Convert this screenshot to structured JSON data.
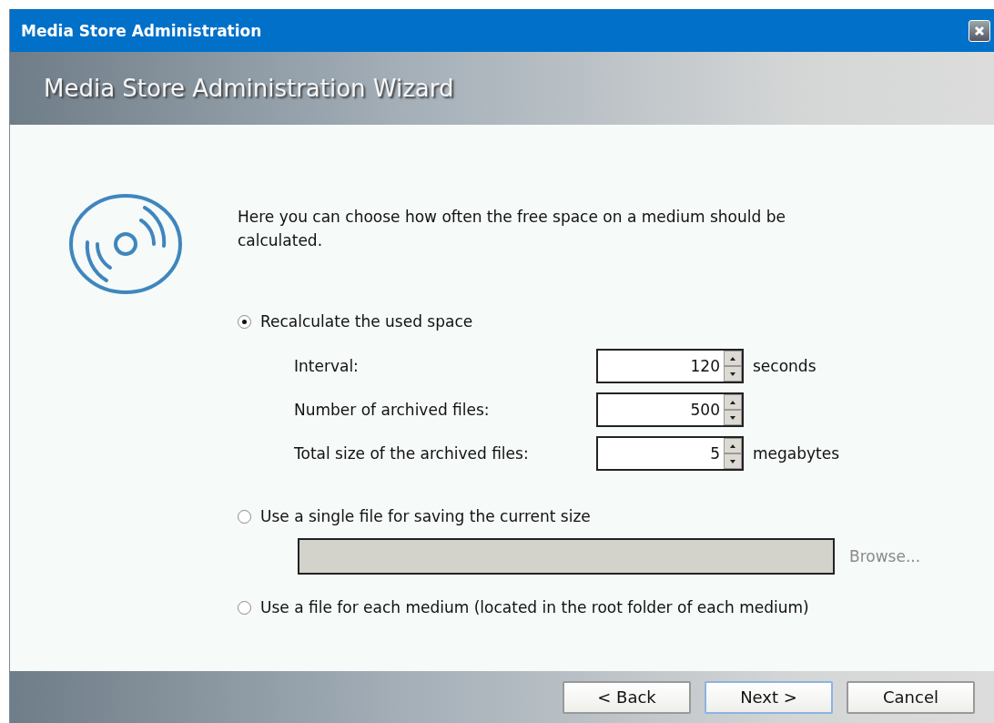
{
  "window": {
    "title": "Media Store Administration"
  },
  "header": {
    "title": "Media Store Administration Wizard"
  },
  "intro": "Here you can choose how often the free space on a medium should be calculated.",
  "options": [
    {
      "kind": "spinners",
      "label": "Recalculate the used space",
      "selected": true,
      "fields": [
        {
          "label": "Interval:",
          "value": "120",
          "unit": "seconds"
        },
        {
          "label": "Number of archived files:",
          "value": "500"
        },
        {
          "label": "Total size of the archived files:",
          "value": "5",
          "unit": "megabytes"
        }
      ]
    },
    {
      "kind": "file",
      "label": "Use a single file for saving the current size",
      "selected": false,
      "browse": {
        "label": "Browse...",
        "disabled": true
      }
    },
    {
      "kind": "plain",
      "label": "Use a file for each medium (located in the root folder of each medium)",
      "selected": false
    }
  ],
  "buttons": [
    {
      "label": "< Back",
      "default": false
    },
    {
      "label": "Next >",
      "default": true
    },
    {
      "label": "Cancel",
      "default": false
    }
  ]
}
